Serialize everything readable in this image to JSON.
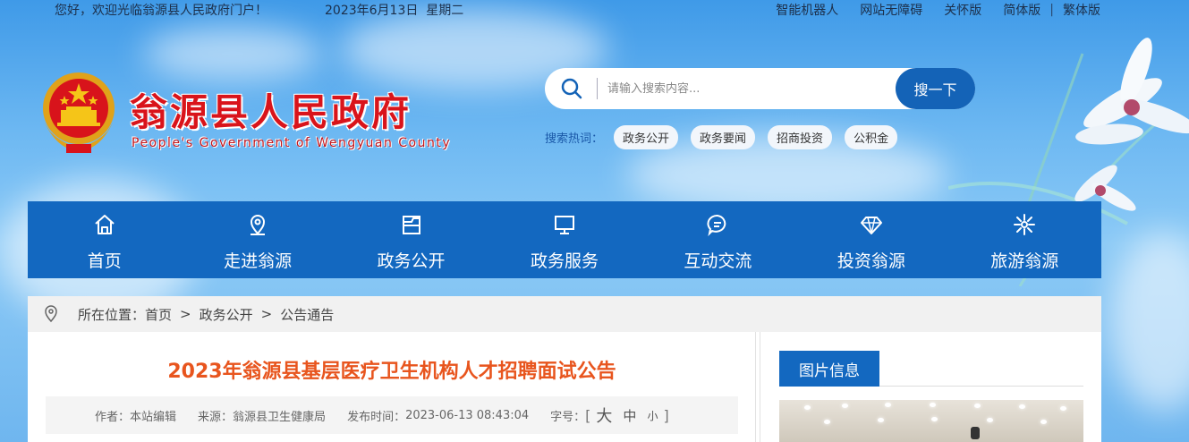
{
  "topbar": {
    "welcome": "您好，欢迎光临翁源县人民政府门户！",
    "date": "2023年6月13日",
    "weekday": "星期二",
    "links": [
      "智能机器人",
      "网站无障碍",
      "关怀版",
      "简体版",
      "繁体版"
    ],
    "separator": "|"
  },
  "logo": {
    "title_cn": "翁源县人民政府",
    "title_en": "People's Government of Wengyuan County"
  },
  "search": {
    "placeholder": "请输入搜索内容...",
    "button": "搜一下",
    "hot_label": "搜索热词：",
    "hot_tags": [
      "政务公开",
      "政务要闻",
      "招商投资",
      "公积金"
    ]
  },
  "nav": [
    {
      "label": "首页",
      "icon": "home-icon"
    },
    {
      "label": "走进翁源",
      "icon": "location-icon"
    },
    {
      "label": "政务公开",
      "icon": "folder-icon"
    },
    {
      "label": "政务服务",
      "icon": "monitor-icon"
    },
    {
      "label": "互动交流",
      "icon": "chat-icon"
    },
    {
      "label": "投资翁源",
      "icon": "diamond-icon"
    },
    {
      "label": "旅游翁源",
      "icon": "flower-icon"
    }
  ],
  "breadcrumb": {
    "label": "所在位置：",
    "items": [
      "首页",
      "政务公开",
      "公告通告"
    ],
    "separator": ">"
  },
  "article": {
    "title": "2023年翁源县基层医疗卫生机构人才招聘面试公告",
    "author_label": "作者：",
    "author": "本站编辑",
    "source_label": "来源：",
    "source": "翁源县卫生健康局",
    "time_label": "发布时间：",
    "time": "2023-06-13 08:43:04",
    "font_label": "字号：",
    "bracket_open": "[",
    "bracket_close": "]",
    "font_large": "大",
    "font_medium": "中",
    "font_small": "小"
  },
  "sidebar": {
    "section_title": "图片信息"
  },
  "colors": {
    "nav_bg": "#1368c0",
    "title_red": "#d9141b",
    "article_title": "#e8551e",
    "search_button": "#1463b7"
  }
}
